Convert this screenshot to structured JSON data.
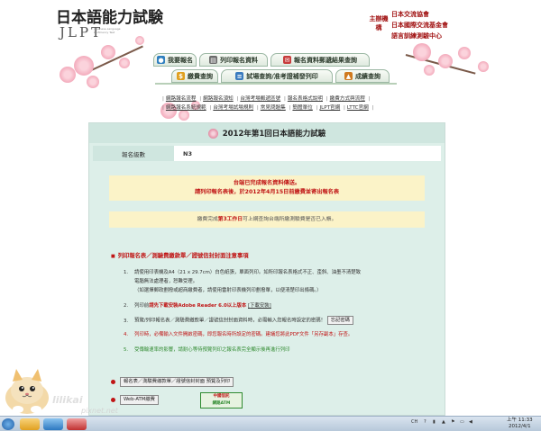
{
  "header": {
    "logo_jp": "日本語能力試験",
    "logo_jlpt": "JLPT",
    "logo_sub": "Japanese-Language Proficiency Test",
    "org_label": "主辦機構",
    "orgs": [
      "日本交流協會",
      "日本國際交流基金會",
      "語言訓練測驗中心"
    ]
  },
  "nav": {
    "tabs": [
      {
        "label": "我要報名",
        "icon": "person-icon",
        "color": "#2f7fbf"
      },
      {
        "label": "列印報名資料",
        "icon": "printer-icon",
        "color": "#6b6b6b"
      },
      {
        "label": "報名資料郵遞結果查詢",
        "icon": "mail-icon",
        "color": "#c73b3b"
      },
      {
        "label": "繳費查詢",
        "icon": "dollar-icon",
        "color": "#e0a020"
      },
      {
        "label": "試場查詢/准考證補發列印",
        "icon": "list-icon",
        "color": "#3b7bbf"
      },
      {
        "label": "成績查詢",
        "icon": "chart-icon",
        "color": "#d07a20"
      }
    ]
  },
  "links": {
    "row1": [
      "網路報名流程",
      "網路報名須知",
      "台灣考場郵遞區號",
      "報名表格式說明",
      "繳費方式與流程",
      "網路報名系統規範"
    ],
    "row2": [
      "台灣考場試場規則",
      "常見問題集",
      "簡體單位",
      "JLPT官網",
      "LTTC官網"
    ]
  },
  "main": {
    "title": "2012年第1回日本語能力試驗",
    "level_label": "報名級數",
    "level_value": "N3",
    "notice_line1": "台端已完成報名資料傳送。",
    "notice_line2": "請列印報名表後，於2012年4月15日前繳費並寄出報名表",
    "notice2_pre": "繳費完成",
    "notice2_red": "第3工作日",
    "notice2_post": "可上網查詢台端所繳測驗費是否已入帳。",
    "section_title": "列印報名表／測驗費繳款單／證號信封封面注意事項",
    "steps": {
      "s1a": "請使用印表機及A4（21 x 29.7cm）白色紙張，單面列印。如所印報名表格式不正、歪斜、油墨不清楚致",
      "s1b": "電腦無法處理者，恕難受理。",
      "s1c": "（如選擇郵政劃撥或超商繳費者，請使用雷射印表機列印劃撥單，以便清楚印出條碼。）",
      "s2_pre": "列印前",
      "s2_link": "請先下載安裝Adobe Reader 6.0以上版本",
      "s2_btn": "下載安裝",
      "s3": "預覽/列印報名表／測驗費繳款單／證號信封封面資料時，必需輸入您報名時設定的密碼！",
      "s3_btn": "忘記密碼",
      "s4": "列印時，必備輸入文件開啟密碼，即您報名時所設定的密碼。建議您將此PDF文件「另存副本」存查。",
      "s5": "受傳輸速率的影響，請耐心等待預覽列印之報名表完全顯示後再進行列印"
    },
    "btn_preview": "報名表／測驗費繳款單／證號信封封面 預覽及列印",
    "btn_webatm": "Web-ATM繳費",
    "atm_logo_top": "中國信託",
    "atm_logo_bottom": "網路ATM"
  },
  "watermark": {
    "text1": "lilikai",
    "text2": "pixnet.net"
  },
  "taskbar": {
    "tray_ch": "CH",
    "time": "上午 11:33",
    "date": "2012/4/1"
  }
}
